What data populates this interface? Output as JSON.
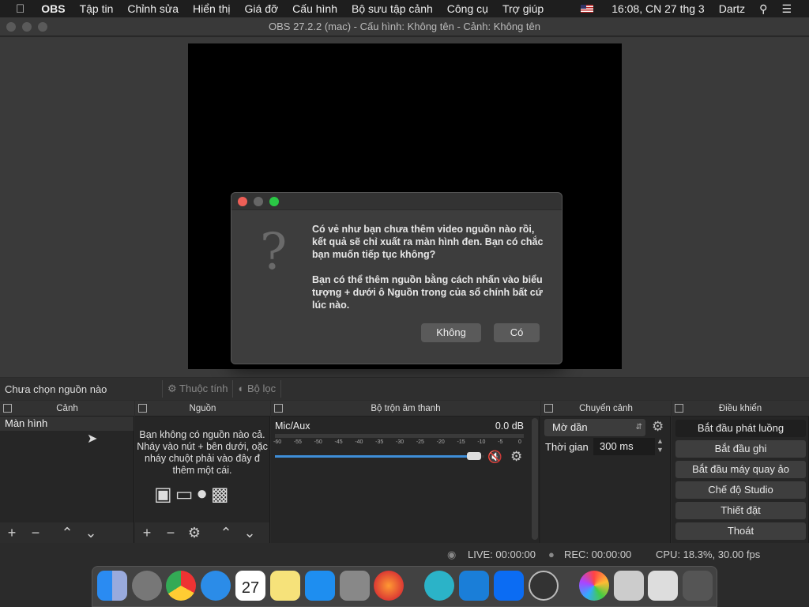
{
  "menubar": {
    "app": "OBS",
    "items": [
      "Tập tin",
      "Chỉnh sửa",
      "Hiển thị",
      "Giá đỡ",
      "Cấu hình",
      "Bộ sưu tập cảnh",
      "Công cụ",
      "Trợ giúp"
    ],
    "clock": "16:08, CN 27 thg 3",
    "user": "Dartz"
  },
  "window": {
    "title": "OBS 27.2.2 (mac) - Cấu hình: Không tên - Cảnh: Không tên"
  },
  "dialog": {
    "line1": "Có vẻ như bạn chưa thêm video nguồn nào rồi, kết quả sẽ chỉ xuất ra màn hình đen. Bạn có chắc bạn muốn tiếp tục không?",
    "line2": "Bạn có thể thêm nguồn bằng cách nhấn vào biểu tượng + dưới ô Nguồn trong của sổ chính bất cứ lúc nào.",
    "no": "Không",
    "yes": "Có",
    "icon": "question-icon"
  },
  "source_bar": {
    "none": "Chưa chọn nguồn nào",
    "properties": "Thuộc tính",
    "filters": "Bộ lọc"
  },
  "docks": {
    "scenes": {
      "title": "Cảnh",
      "item": "Màn hình"
    },
    "sources": {
      "title": "Nguồn",
      "empty": "Bạn không có nguồn nào cả. Nháy vào nút + bên dưới, oặc nháy chuột phải vào đây đ thêm một cái."
    },
    "mixer": {
      "title": "Bộ trộn âm thanh",
      "channel": "Mic/Aux",
      "level": "0.0 dB",
      "ticks": [
        "-60",
        "-55",
        "-50",
        "-45",
        "-40",
        "-35",
        "-30",
        "-25",
        "-20",
        "-15",
        "-10",
        "-5",
        "0"
      ],
      "volume": 0.95,
      "muted": true
    },
    "transitions": {
      "title": "Chuyển cảnh",
      "type": "Mờ dần",
      "duration_label": "Thời gian",
      "duration": "300 ms"
    },
    "controls": {
      "title": "Điều khiển",
      "buttons": [
        "Bắt đầu phát luồng",
        "Bắt đầu ghi",
        "Bắt đầu máy quay ảo",
        "Chế độ Studio",
        "Thiết đặt",
        "Thoát"
      ]
    }
  },
  "status": {
    "live": "LIVE: 00:00:00",
    "rec": "REC: 00:00:00",
    "cpu": "CPU: 18.3%, 30.00 fps"
  },
  "dock_apps": {
    "calendar_day": "27"
  }
}
